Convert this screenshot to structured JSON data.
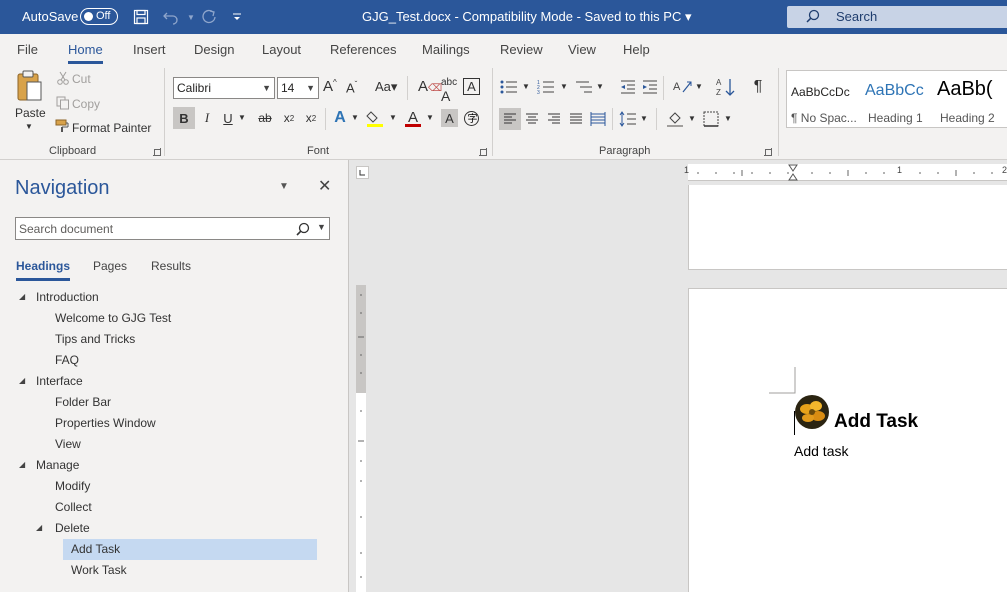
{
  "titlebar": {
    "autosave_label": "AutoSave",
    "autosave_state": "Off",
    "document_title": "GJG_Test.docx  -  Compatibility Mode  -  Saved to this PC  ▾",
    "search_label": "Search"
  },
  "tabs": [
    "File",
    "Home",
    "Insert",
    "Design",
    "Layout",
    "References",
    "Mailings",
    "Review",
    "View",
    "Help"
  ],
  "ribbon": {
    "clipboard": {
      "paste_label": "Paste",
      "cut_label": "Cut",
      "copy_label": "Copy",
      "format_painter_label": "Format Painter",
      "group_label": "Clipboard"
    },
    "font": {
      "font_name": "Calibri",
      "font_size": "14",
      "group_label": "Font"
    },
    "paragraph": {
      "group_label": "Paragraph"
    },
    "styles": [
      {
        "preview": "AaBbCcDc",
        "name": "¶ No Spac..."
      },
      {
        "preview": "AaBbCc",
        "name": "Heading 1"
      },
      {
        "preview": "AaBb(",
        "name": "Heading 2"
      }
    ],
    "colors": {
      "highlight": "#ffff00",
      "font_color": "#c00000"
    }
  },
  "navigation": {
    "title": "Navigation",
    "search_placeholder": "Search document",
    "tabs": [
      "Headings",
      "Pages",
      "Results"
    ],
    "headings": [
      {
        "label": "Introduction",
        "level": 1,
        "expanded": true
      },
      {
        "label": "Welcome to GJG Test",
        "level": 2
      },
      {
        "label": "Tips and Tricks",
        "level": 2
      },
      {
        "label": "FAQ",
        "level": 2
      },
      {
        "label": "Interface",
        "level": 1,
        "expanded": true
      },
      {
        "label": "Folder Bar",
        "level": 2
      },
      {
        "label": "Properties Window",
        "level": 2
      },
      {
        "label": "View",
        "level": 2
      },
      {
        "label": "Manage",
        "level": 1,
        "expanded": true
      },
      {
        "label": "Modify",
        "level": 2
      },
      {
        "label": "Collect",
        "level": 2
      },
      {
        "label": "Delete",
        "level": 2,
        "expanded": true
      },
      {
        "label": "Add Task",
        "level": 3,
        "selected": true
      },
      {
        "label": "Work Task",
        "level": 3
      }
    ]
  },
  "document": {
    "ruler_left_number": "1",
    "ruler_mid_number": "1",
    "ruler_right_number": "2",
    "heading": "Add Task",
    "body": "Add task"
  }
}
